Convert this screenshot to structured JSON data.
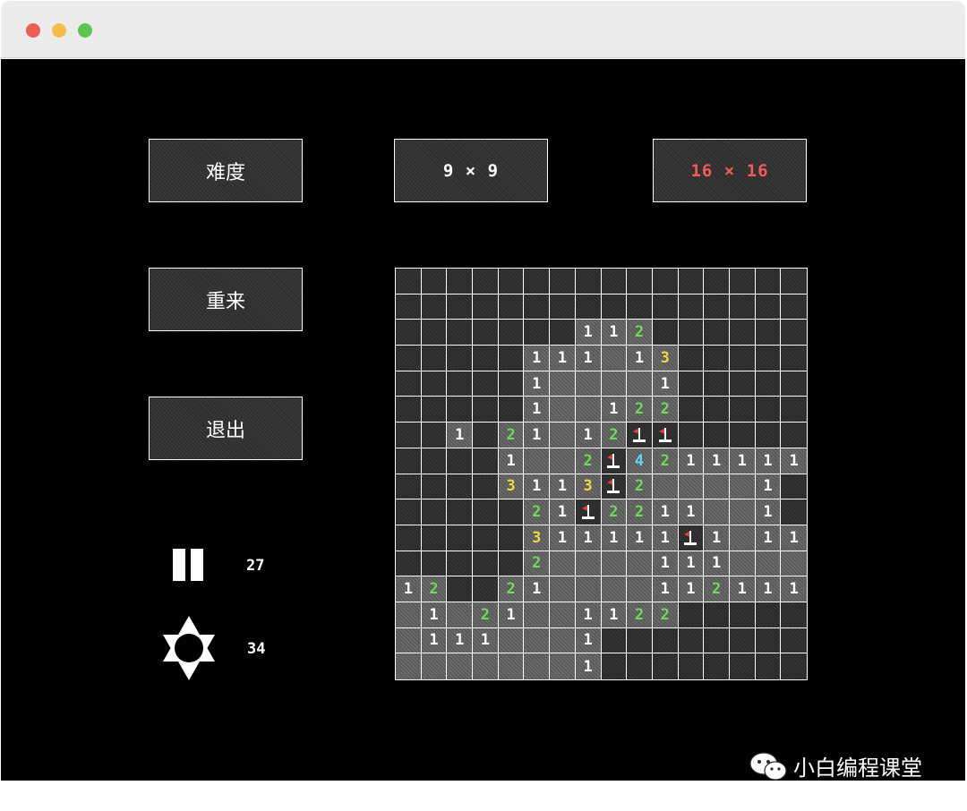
{
  "window": {
    "traffic_colors": [
      "#ec5f57",
      "#f4bd4f",
      "#5fc454"
    ]
  },
  "menu": {
    "difficulty_label": "难度",
    "size_small_label": "9 × 9",
    "size_large_label": "16 × 16",
    "restart_label": "重来",
    "exit_label": "退出"
  },
  "stats": {
    "pause_icon": "pause-icon",
    "mine_icon": "mine-icon",
    "time": "27",
    "mines": "34"
  },
  "colors": {
    "1": "#ffffff",
    "2": "#6ddc58",
    "3": "#f1da3f",
    "4": "#5bd8f5",
    "selected_size": "#f05a5a",
    "flag": "#e24040"
  },
  "board": {
    "size": 16,
    "legend": "H = hidden, . = opened empty, digit = adjacent mines, F = flag",
    "rows": [
      "HHHHHHHHHHHHHHHH",
      "HHHHHHHHHHHHHHHH",
      "HHHHHHH112HHHHHH",
      "HHHHH111.13HHHHH",
      "HHHHH1....1HHHHH",
      "HHHHH1..122HHHHH",
      "HH1H21.12FFHHHHH",
      "HHHH1..2F4211111",
      "HHHH3113F2....1H",
      "HHHHH21F2211..1H",
      "HHHHH311111F1.11",
      "HHHHH2....111...",
      "12HH21....11211121",
      ".1.21..1122HHHHH",
      ".111...1HHHHHHHH",
      ".......1HHHHHHHH"
    ]
  },
  "watermark": {
    "text": "小白编程课堂",
    "icon": "wechat-icon"
  }
}
